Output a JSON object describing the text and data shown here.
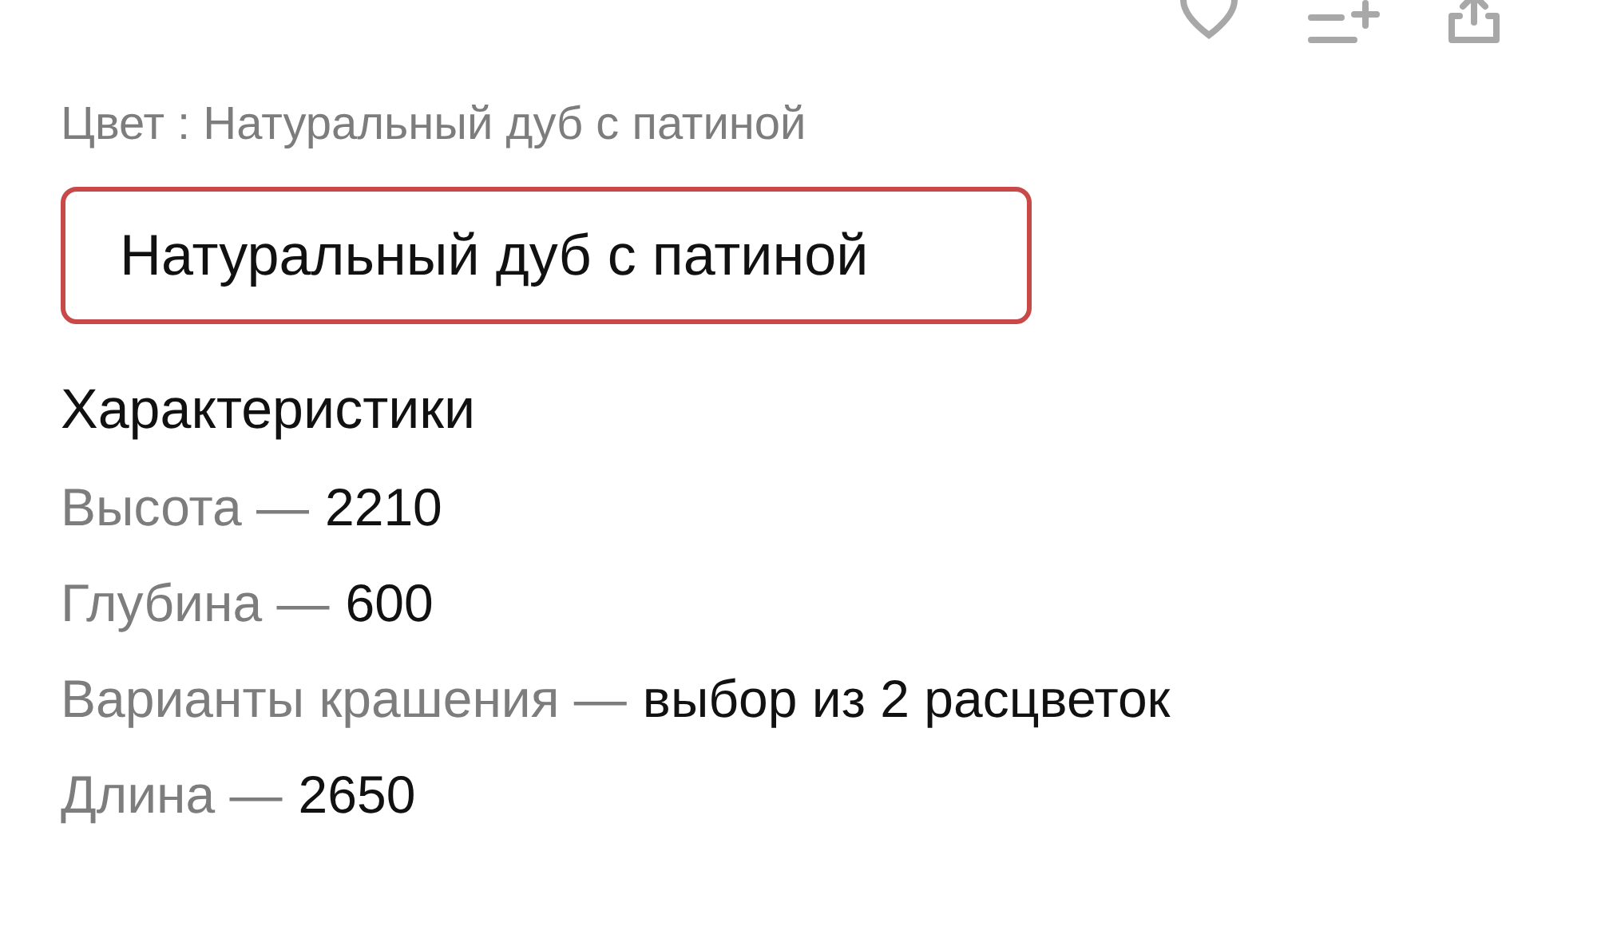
{
  "color": {
    "label": "Цвет : Натуральный дуб с патиной",
    "option": {
      "label": "Натуральный дуб с патиной",
      "selected": true
    }
  },
  "specs": {
    "title": "Характеристики",
    "items": [
      {
        "name": "Высота —",
        "value": "2210"
      },
      {
        "name": "Глубина —",
        "value": "600"
      },
      {
        "name": "Варианты крашения —",
        "value": "выбор из 2 расцветок"
      },
      {
        "name": "Длина —",
        "value": "2650"
      }
    ]
  }
}
